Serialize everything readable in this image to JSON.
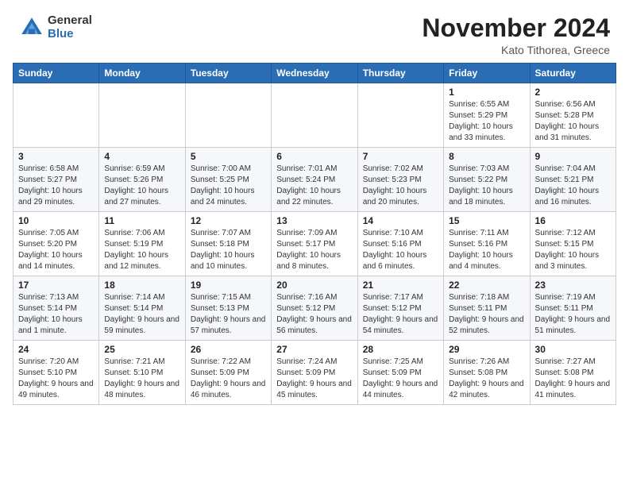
{
  "header": {
    "logo_general": "General",
    "logo_blue": "Blue",
    "month_title": "November 2024",
    "location": "Kato Tithorea, Greece"
  },
  "weekdays": [
    "Sunday",
    "Monday",
    "Tuesday",
    "Wednesday",
    "Thursday",
    "Friday",
    "Saturday"
  ],
  "weeks": [
    [
      {
        "day": "",
        "info": ""
      },
      {
        "day": "",
        "info": ""
      },
      {
        "day": "",
        "info": ""
      },
      {
        "day": "",
        "info": ""
      },
      {
        "day": "",
        "info": ""
      },
      {
        "day": "1",
        "info": "Sunrise: 6:55 AM\nSunset: 5:29 PM\nDaylight: 10 hours and 33 minutes."
      },
      {
        "day": "2",
        "info": "Sunrise: 6:56 AM\nSunset: 5:28 PM\nDaylight: 10 hours and 31 minutes."
      }
    ],
    [
      {
        "day": "3",
        "info": "Sunrise: 6:58 AM\nSunset: 5:27 PM\nDaylight: 10 hours and 29 minutes."
      },
      {
        "day": "4",
        "info": "Sunrise: 6:59 AM\nSunset: 5:26 PM\nDaylight: 10 hours and 27 minutes."
      },
      {
        "day": "5",
        "info": "Sunrise: 7:00 AM\nSunset: 5:25 PM\nDaylight: 10 hours and 24 minutes."
      },
      {
        "day": "6",
        "info": "Sunrise: 7:01 AM\nSunset: 5:24 PM\nDaylight: 10 hours and 22 minutes."
      },
      {
        "day": "7",
        "info": "Sunrise: 7:02 AM\nSunset: 5:23 PM\nDaylight: 10 hours and 20 minutes."
      },
      {
        "day": "8",
        "info": "Sunrise: 7:03 AM\nSunset: 5:22 PM\nDaylight: 10 hours and 18 minutes."
      },
      {
        "day": "9",
        "info": "Sunrise: 7:04 AM\nSunset: 5:21 PM\nDaylight: 10 hours and 16 minutes."
      }
    ],
    [
      {
        "day": "10",
        "info": "Sunrise: 7:05 AM\nSunset: 5:20 PM\nDaylight: 10 hours and 14 minutes."
      },
      {
        "day": "11",
        "info": "Sunrise: 7:06 AM\nSunset: 5:19 PM\nDaylight: 10 hours and 12 minutes."
      },
      {
        "day": "12",
        "info": "Sunrise: 7:07 AM\nSunset: 5:18 PM\nDaylight: 10 hours and 10 minutes."
      },
      {
        "day": "13",
        "info": "Sunrise: 7:09 AM\nSunset: 5:17 PM\nDaylight: 10 hours and 8 minutes."
      },
      {
        "day": "14",
        "info": "Sunrise: 7:10 AM\nSunset: 5:16 PM\nDaylight: 10 hours and 6 minutes."
      },
      {
        "day": "15",
        "info": "Sunrise: 7:11 AM\nSunset: 5:16 PM\nDaylight: 10 hours and 4 minutes."
      },
      {
        "day": "16",
        "info": "Sunrise: 7:12 AM\nSunset: 5:15 PM\nDaylight: 10 hours and 3 minutes."
      }
    ],
    [
      {
        "day": "17",
        "info": "Sunrise: 7:13 AM\nSunset: 5:14 PM\nDaylight: 10 hours and 1 minute."
      },
      {
        "day": "18",
        "info": "Sunrise: 7:14 AM\nSunset: 5:14 PM\nDaylight: 9 hours and 59 minutes."
      },
      {
        "day": "19",
        "info": "Sunrise: 7:15 AM\nSunset: 5:13 PM\nDaylight: 9 hours and 57 minutes."
      },
      {
        "day": "20",
        "info": "Sunrise: 7:16 AM\nSunset: 5:12 PM\nDaylight: 9 hours and 56 minutes."
      },
      {
        "day": "21",
        "info": "Sunrise: 7:17 AM\nSunset: 5:12 PM\nDaylight: 9 hours and 54 minutes."
      },
      {
        "day": "22",
        "info": "Sunrise: 7:18 AM\nSunset: 5:11 PM\nDaylight: 9 hours and 52 minutes."
      },
      {
        "day": "23",
        "info": "Sunrise: 7:19 AM\nSunset: 5:11 PM\nDaylight: 9 hours and 51 minutes."
      }
    ],
    [
      {
        "day": "24",
        "info": "Sunrise: 7:20 AM\nSunset: 5:10 PM\nDaylight: 9 hours and 49 minutes."
      },
      {
        "day": "25",
        "info": "Sunrise: 7:21 AM\nSunset: 5:10 PM\nDaylight: 9 hours and 48 minutes."
      },
      {
        "day": "26",
        "info": "Sunrise: 7:22 AM\nSunset: 5:09 PM\nDaylight: 9 hours and 46 minutes."
      },
      {
        "day": "27",
        "info": "Sunrise: 7:24 AM\nSunset: 5:09 PM\nDaylight: 9 hours and 45 minutes."
      },
      {
        "day": "28",
        "info": "Sunrise: 7:25 AM\nSunset: 5:09 PM\nDaylight: 9 hours and 44 minutes."
      },
      {
        "day": "29",
        "info": "Sunrise: 7:26 AM\nSunset: 5:08 PM\nDaylight: 9 hours and 42 minutes."
      },
      {
        "day": "30",
        "info": "Sunrise: 7:27 AM\nSunset: 5:08 PM\nDaylight: 9 hours and 41 minutes."
      }
    ]
  ]
}
